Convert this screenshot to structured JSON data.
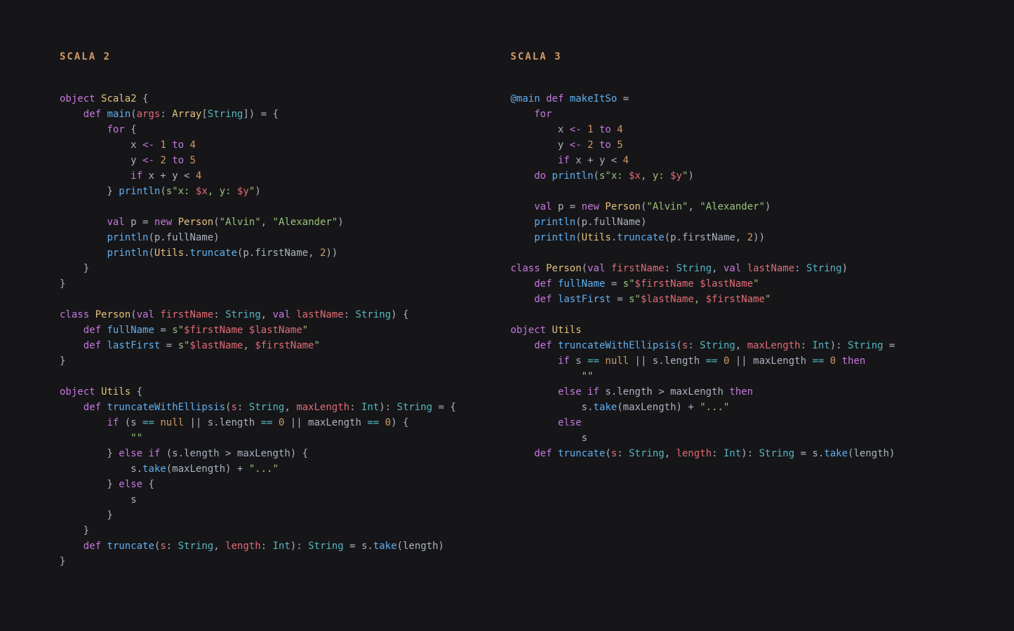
{
  "left": {
    "heading": "SCALA 2",
    "tokens": [
      [
        [
          "kw",
          "object"
        ],
        [
          "op",
          " "
        ],
        [
          "nm",
          "Scala2"
        ],
        [
          "op",
          " {"
        ]
      ],
      [
        [
          "op",
          "    "
        ],
        [
          "kw",
          "def"
        ],
        [
          "op",
          " "
        ],
        [
          "fn",
          "main"
        ],
        [
          "op",
          "("
        ],
        [
          "va",
          "args"
        ],
        [
          "op",
          ": "
        ],
        [
          "nm",
          "Array"
        ],
        [
          "op",
          "["
        ],
        [
          "ty",
          "String"
        ],
        [
          "op",
          "]) = {"
        ]
      ],
      [
        [
          "op",
          "        "
        ],
        [
          "kw",
          "for"
        ],
        [
          "op",
          " {"
        ]
      ],
      [
        [
          "op",
          "            x "
        ],
        [
          "kw",
          "<-"
        ],
        [
          "op",
          " "
        ],
        [
          "nu",
          "1"
        ],
        [
          "op",
          " "
        ],
        [
          "kw",
          "to"
        ],
        [
          "op",
          " "
        ],
        [
          "nu",
          "4"
        ]
      ],
      [
        [
          "op",
          "            y "
        ],
        [
          "kw",
          "<-"
        ],
        [
          "op",
          " "
        ],
        [
          "nu",
          "2"
        ],
        [
          "op",
          " "
        ],
        [
          "kw",
          "to"
        ],
        [
          "op",
          " "
        ],
        [
          "nu",
          "5"
        ]
      ],
      [
        [
          "op",
          "            "
        ],
        [
          "kw",
          "if"
        ],
        [
          "op",
          " x + y < "
        ],
        [
          "nu",
          "4"
        ]
      ],
      [
        [
          "op",
          "        } "
        ],
        [
          "fn",
          "println"
        ],
        [
          "op",
          "("
        ],
        [
          "st",
          "s\"x: "
        ],
        [
          "interp",
          "$x"
        ],
        [
          "st",
          ", y: "
        ],
        [
          "interp",
          "$y"
        ],
        [
          "st",
          "\""
        ],
        [
          "op",
          ")"
        ]
      ],
      [
        [
          "op",
          ""
        ]
      ],
      [
        [
          "op",
          "        "
        ],
        [
          "kw",
          "val"
        ],
        [
          "op",
          " p = "
        ],
        [
          "kw",
          "new"
        ],
        [
          "op",
          " "
        ],
        [
          "nm",
          "Person"
        ],
        [
          "op",
          "("
        ],
        [
          "st",
          "\"Alvin\""
        ],
        [
          "op",
          ", "
        ],
        [
          "st",
          "\"Alexander\""
        ],
        [
          "op",
          ")"
        ]
      ],
      [
        [
          "op",
          "        "
        ],
        [
          "fn",
          "println"
        ],
        [
          "op",
          "(p.fullName)"
        ]
      ],
      [
        [
          "op",
          "        "
        ],
        [
          "fn",
          "println"
        ],
        [
          "op",
          "("
        ],
        [
          "nm",
          "Utils"
        ],
        [
          "op",
          "."
        ],
        [
          "fn",
          "truncate"
        ],
        [
          "op",
          "(p.firstName, "
        ],
        [
          "nu",
          "2"
        ],
        [
          "op",
          "))"
        ]
      ],
      [
        [
          "op",
          "    }"
        ]
      ],
      [
        [
          "op",
          "}"
        ]
      ],
      [
        [
          "op",
          ""
        ]
      ],
      [
        [
          "kw",
          "class"
        ],
        [
          "op",
          " "
        ],
        [
          "nm",
          "Person"
        ],
        [
          "op",
          "("
        ],
        [
          "kw",
          "val"
        ],
        [
          "op",
          " "
        ],
        [
          "va",
          "firstName"
        ],
        [
          "op",
          ": "
        ],
        [
          "ty",
          "String"
        ],
        [
          "op",
          ", "
        ],
        [
          "kw",
          "val"
        ],
        [
          "op",
          " "
        ],
        [
          "va",
          "lastName"
        ],
        [
          "op",
          ": "
        ],
        [
          "ty",
          "String"
        ],
        [
          "op",
          ") {"
        ]
      ],
      [
        [
          "op",
          "    "
        ],
        [
          "kw",
          "def"
        ],
        [
          "op",
          " "
        ],
        [
          "fn",
          "fullName"
        ],
        [
          "op",
          " = "
        ],
        [
          "st",
          "s\""
        ],
        [
          "interp",
          "$firstName"
        ],
        [
          "st",
          " "
        ],
        [
          "interp",
          "$lastName"
        ],
        [
          "st",
          "\""
        ]
      ],
      [
        [
          "op",
          "    "
        ],
        [
          "kw",
          "def"
        ],
        [
          "op",
          " "
        ],
        [
          "fn",
          "lastFirst"
        ],
        [
          "op",
          " = "
        ],
        [
          "st",
          "s\""
        ],
        [
          "interp",
          "$lastName"
        ],
        [
          "st",
          ", "
        ],
        [
          "interp",
          "$firstName"
        ],
        [
          "st",
          "\""
        ]
      ],
      [
        [
          "op",
          "}"
        ]
      ],
      [
        [
          "op",
          ""
        ]
      ],
      [
        [
          "kw",
          "object"
        ],
        [
          "op",
          " "
        ],
        [
          "nm",
          "Utils"
        ],
        [
          "op",
          " {"
        ]
      ],
      [
        [
          "op",
          "    "
        ],
        [
          "kw",
          "def"
        ],
        [
          "op",
          " "
        ],
        [
          "fn",
          "truncateWithEllipsis"
        ],
        [
          "op",
          "("
        ],
        [
          "va",
          "s"
        ],
        [
          "op",
          ": "
        ],
        [
          "ty",
          "String"
        ],
        [
          "op",
          ", "
        ],
        [
          "va",
          "maxLength"
        ],
        [
          "op",
          ": "
        ],
        [
          "ty",
          "Int"
        ],
        [
          "op",
          "): "
        ],
        [
          "ty",
          "String"
        ],
        [
          "op",
          " = {"
        ]
      ],
      [
        [
          "op",
          "        "
        ],
        [
          "kw",
          "if"
        ],
        [
          "op",
          " (s "
        ],
        [
          "cy",
          "=="
        ],
        [
          "op",
          " "
        ],
        [
          "nu",
          "null"
        ],
        [
          "op",
          " || s.length "
        ],
        [
          "cy",
          "=="
        ],
        [
          "op",
          " "
        ],
        [
          "nu",
          "0"
        ],
        [
          "op",
          " || maxLength "
        ],
        [
          "cy",
          "=="
        ],
        [
          "op",
          " "
        ],
        [
          "nu",
          "0"
        ],
        [
          "op",
          ") {"
        ]
      ],
      [
        [
          "op",
          "            "
        ],
        [
          "st",
          "\"\""
        ]
      ],
      [
        [
          "op",
          "        } "
        ],
        [
          "kw",
          "else"
        ],
        [
          "op",
          " "
        ],
        [
          "kw",
          "if"
        ],
        [
          "op",
          " (s.length > maxLength) {"
        ]
      ],
      [
        [
          "op",
          "            s."
        ],
        [
          "fn",
          "take"
        ],
        [
          "op",
          "(maxLength) + "
        ],
        [
          "st",
          "\"...\""
        ]
      ],
      [
        [
          "op",
          "        } "
        ],
        [
          "kw",
          "else"
        ],
        [
          "op",
          " {"
        ]
      ],
      [
        [
          "op",
          "            s"
        ]
      ],
      [
        [
          "op",
          "        }"
        ]
      ],
      [
        [
          "op",
          "    }"
        ]
      ],
      [
        [
          "op",
          "    "
        ],
        [
          "kw",
          "def"
        ],
        [
          "op",
          " "
        ],
        [
          "fn",
          "truncate"
        ],
        [
          "op",
          "("
        ],
        [
          "va",
          "s"
        ],
        [
          "op",
          ": "
        ],
        [
          "ty",
          "String"
        ],
        [
          "op",
          ", "
        ],
        [
          "va",
          "length"
        ],
        [
          "op",
          ": "
        ],
        [
          "ty",
          "Int"
        ],
        [
          "op",
          "): "
        ],
        [
          "ty",
          "String"
        ],
        [
          "op",
          " = s."
        ],
        [
          "fn",
          "take"
        ],
        [
          "op",
          "(length)"
        ]
      ],
      [
        [
          "op",
          "}"
        ]
      ]
    ]
  },
  "right": {
    "heading": "SCALA 3",
    "tokens": [
      [
        [
          "fn",
          "@main"
        ],
        [
          "op",
          " "
        ],
        [
          "kw",
          "def"
        ],
        [
          "op",
          " "
        ],
        [
          "fn",
          "makeItSo"
        ],
        [
          "op",
          " ="
        ]
      ],
      [
        [
          "op",
          "    "
        ],
        [
          "kw",
          "for"
        ]
      ],
      [
        [
          "op",
          "        x "
        ],
        [
          "kw",
          "<-"
        ],
        [
          "op",
          " "
        ],
        [
          "nu",
          "1"
        ],
        [
          "op",
          " "
        ],
        [
          "kw",
          "to"
        ],
        [
          "op",
          " "
        ],
        [
          "nu",
          "4"
        ]
      ],
      [
        [
          "op",
          "        y "
        ],
        [
          "kw",
          "<-"
        ],
        [
          "op",
          " "
        ],
        [
          "nu",
          "2"
        ],
        [
          "op",
          " "
        ],
        [
          "kw",
          "to"
        ],
        [
          "op",
          " "
        ],
        [
          "nu",
          "5"
        ]
      ],
      [
        [
          "op",
          "        "
        ],
        [
          "kw",
          "if"
        ],
        [
          "op",
          " x + y < "
        ],
        [
          "nu",
          "4"
        ]
      ],
      [
        [
          "op",
          "    "
        ],
        [
          "kw",
          "do"
        ],
        [
          "op",
          " "
        ],
        [
          "fn",
          "println"
        ],
        [
          "op",
          "("
        ],
        [
          "st",
          "s\"x: "
        ],
        [
          "interp",
          "$x"
        ],
        [
          "st",
          ", y: "
        ],
        [
          "interp",
          "$y"
        ],
        [
          "st",
          "\""
        ],
        [
          "op",
          ")"
        ]
      ],
      [
        [
          "op",
          ""
        ]
      ],
      [
        [
          "op",
          "    "
        ],
        [
          "kw",
          "val"
        ],
        [
          "op",
          " p = "
        ],
        [
          "kw",
          "new"
        ],
        [
          "op",
          " "
        ],
        [
          "nm",
          "Person"
        ],
        [
          "op",
          "("
        ],
        [
          "st",
          "\"Alvin\""
        ],
        [
          "op",
          ", "
        ],
        [
          "st",
          "\"Alexander\""
        ],
        [
          "op",
          ")"
        ]
      ],
      [
        [
          "op",
          "    "
        ],
        [
          "fn",
          "println"
        ],
        [
          "op",
          "(p.fullName)"
        ]
      ],
      [
        [
          "op",
          "    "
        ],
        [
          "fn",
          "println"
        ],
        [
          "op",
          "("
        ],
        [
          "nm",
          "Utils"
        ],
        [
          "op",
          "."
        ],
        [
          "fn",
          "truncate"
        ],
        [
          "op",
          "(p.firstName, "
        ],
        [
          "nu",
          "2"
        ],
        [
          "op",
          "))"
        ]
      ],
      [
        [
          "op",
          ""
        ]
      ],
      [
        [
          "kw",
          "class"
        ],
        [
          "op",
          " "
        ],
        [
          "nm",
          "Person"
        ],
        [
          "op",
          "("
        ],
        [
          "kw",
          "val"
        ],
        [
          "op",
          " "
        ],
        [
          "va",
          "firstName"
        ],
        [
          "op",
          ": "
        ],
        [
          "ty",
          "String"
        ],
        [
          "op",
          ", "
        ],
        [
          "kw",
          "val"
        ],
        [
          "op",
          " "
        ],
        [
          "va",
          "lastName"
        ],
        [
          "op",
          ": "
        ],
        [
          "ty",
          "String"
        ],
        [
          "op",
          ")"
        ]
      ],
      [
        [
          "op",
          "    "
        ],
        [
          "kw",
          "def"
        ],
        [
          "op",
          " "
        ],
        [
          "fn",
          "fullName"
        ],
        [
          "op",
          " = "
        ],
        [
          "st",
          "s\""
        ],
        [
          "interp",
          "$firstName"
        ],
        [
          "st",
          " "
        ],
        [
          "interp",
          "$lastName"
        ],
        [
          "st",
          "\""
        ]
      ],
      [
        [
          "op",
          "    "
        ],
        [
          "kw",
          "def"
        ],
        [
          "op",
          " "
        ],
        [
          "fn",
          "lastFirst"
        ],
        [
          "op",
          " = "
        ],
        [
          "st",
          "s\""
        ],
        [
          "interp",
          "$lastName"
        ],
        [
          "st",
          ", "
        ],
        [
          "interp",
          "$firstName"
        ],
        [
          "st",
          "\""
        ]
      ],
      [
        [
          "op",
          ""
        ]
      ],
      [
        [
          "kw",
          "object"
        ],
        [
          "op",
          " "
        ],
        [
          "nm",
          "Utils"
        ]
      ],
      [
        [
          "op",
          "    "
        ],
        [
          "kw",
          "def"
        ],
        [
          "op",
          " "
        ],
        [
          "fn",
          "truncateWithEllipsis"
        ],
        [
          "op",
          "("
        ],
        [
          "va",
          "s"
        ],
        [
          "op",
          ": "
        ],
        [
          "ty",
          "String"
        ],
        [
          "op",
          ", "
        ],
        [
          "va",
          "maxLength"
        ],
        [
          "op",
          ": "
        ],
        [
          "ty",
          "Int"
        ],
        [
          "op",
          "): "
        ],
        [
          "ty",
          "String"
        ],
        [
          "op",
          " ="
        ]
      ],
      [
        [
          "op",
          "        "
        ],
        [
          "kw",
          "if"
        ],
        [
          "op",
          " s "
        ],
        [
          "cy",
          "=="
        ],
        [
          "op",
          " "
        ],
        [
          "nu",
          "null"
        ],
        [
          "op",
          " || s.length "
        ],
        [
          "cy",
          "=="
        ],
        [
          "op",
          " "
        ],
        [
          "nu",
          "0"
        ],
        [
          "op",
          " || maxLength "
        ],
        [
          "cy",
          "=="
        ],
        [
          "op",
          " "
        ],
        [
          "nu",
          "0"
        ],
        [
          "op",
          " "
        ],
        [
          "kw",
          "then"
        ]
      ],
      [
        [
          "op",
          "            "
        ],
        [
          "st",
          "\"\""
        ]
      ],
      [
        [
          "op",
          "        "
        ],
        [
          "kw",
          "else"
        ],
        [
          "op",
          " "
        ],
        [
          "kw",
          "if"
        ],
        [
          "op",
          " s.length > maxLength "
        ],
        [
          "kw",
          "then"
        ]
      ],
      [
        [
          "op",
          "            s."
        ],
        [
          "fn",
          "take"
        ],
        [
          "op",
          "(maxLength) + "
        ],
        [
          "st",
          "\"...\""
        ]
      ],
      [
        [
          "op",
          "        "
        ],
        [
          "kw",
          "else"
        ]
      ],
      [
        [
          "op",
          "            s"
        ]
      ],
      [
        [
          "op",
          "    "
        ],
        [
          "kw",
          "def"
        ],
        [
          "op",
          " "
        ],
        [
          "fn",
          "truncate"
        ],
        [
          "op",
          "("
        ],
        [
          "va",
          "s"
        ],
        [
          "op",
          ": "
        ],
        [
          "ty",
          "String"
        ],
        [
          "op",
          ", "
        ],
        [
          "va",
          "length"
        ],
        [
          "op",
          ": "
        ],
        [
          "ty",
          "Int"
        ],
        [
          "op",
          "): "
        ],
        [
          "ty",
          "String"
        ],
        [
          "op",
          " = s."
        ],
        [
          "fn",
          "take"
        ],
        [
          "op",
          "(length)"
        ]
      ]
    ]
  }
}
